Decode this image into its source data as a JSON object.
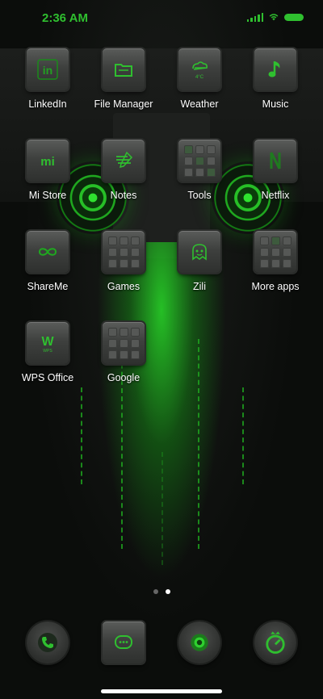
{
  "status_bar": {
    "time": "2:36 AM"
  },
  "accent": "#2fbf2f",
  "apps": [
    {
      "label": "LinkedIn",
      "icon": "linkedin-icon",
      "glyph": "in"
    },
    {
      "label": "File Manager",
      "icon": "folder-icon"
    },
    {
      "label": "Weather",
      "icon": "weather-icon",
      "glyph": "4°C"
    },
    {
      "label": "Music",
      "icon": "music-note-icon"
    },
    {
      "label": "Mi Store",
      "icon": "mi-icon",
      "glyph": "mi"
    },
    {
      "label": "Notes",
      "icon": "notes-icon"
    },
    {
      "label": "Tools",
      "icon": "tools-icon"
    },
    {
      "label": "Netflix",
      "icon": "netflix-icon"
    },
    {
      "label": "ShareMe",
      "icon": "infinity-icon"
    },
    {
      "label": "Games",
      "icon": "games-folder-icon"
    },
    {
      "label": "Zili",
      "icon": "zili-icon"
    },
    {
      "label": "More apps",
      "icon": "more-apps-folder-icon"
    },
    {
      "label": "WPS Office",
      "icon": "wps-icon",
      "glyph": "W",
      "sub_glyph": "WPS"
    },
    {
      "label": "Google",
      "icon": "google-folder-icon"
    }
  ],
  "page_indicator": {
    "pages": 2,
    "active": 2
  },
  "dock": [
    {
      "icon": "phone-icon"
    },
    {
      "icon": "messages-icon"
    },
    {
      "icon": "camera-icon"
    },
    {
      "icon": "security-icon"
    }
  ]
}
